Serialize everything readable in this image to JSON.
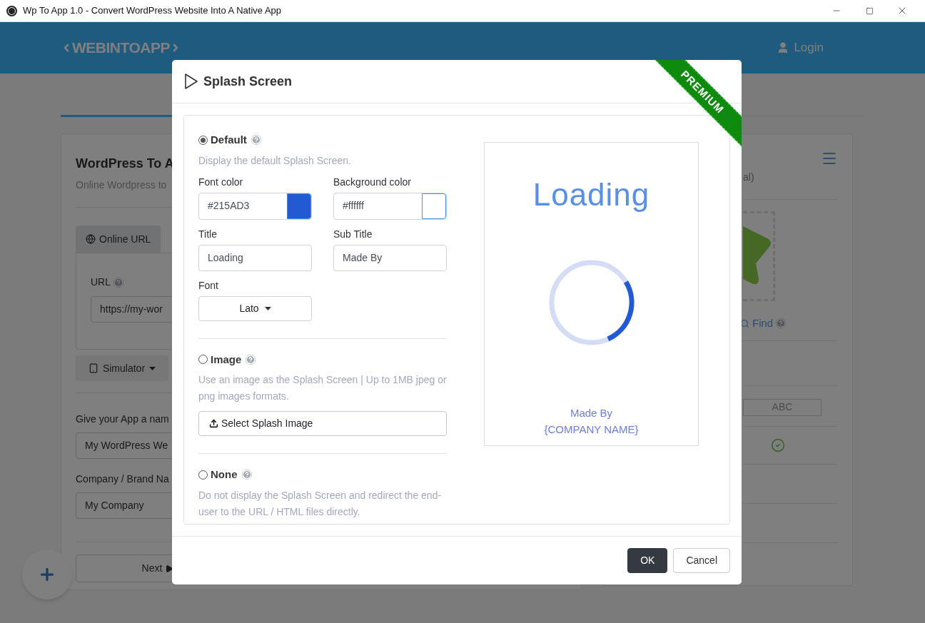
{
  "window": {
    "title": "Wp To App 1.0 - Convert WordPress Website Into A Native App"
  },
  "header": {
    "logo": "WEBINTOAPP",
    "login": "Login"
  },
  "main_card": {
    "title": "WordPress To A",
    "subtitle": "Online Wordpress to",
    "tabs": [
      {
        "label": "Online URL",
        "selected": true
      }
    ],
    "url_label": "URL",
    "url_value": "https://my-wor",
    "simulator": "Simulator",
    "fields": [
      {
        "label": "Give your App a nam",
        "value": "My WordPress We"
      },
      {
        "label": "Company / Brand Na",
        "value": "My Company"
      }
    ],
    "next": "Next"
  },
  "side_card": {
    "caption": "al)",
    "find": "Find",
    "sample": "ABC"
  },
  "dialog": {
    "title": "Splash Screen",
    "ribbon": "PREMIUM",
    "options": [
      {
        "kind": "default",
        "label": "Default",
        "selected": true,
        "description": "Display the default Splash Screen.",
        "fields": [
          {
            "kind": "color",
            "label": "Font color",
            "value": "#215AD3",
            "color": "#215ad3"
          },
          {
            "kind": "color",
            "label": "Background color",
            "value": "#ffffff",
            "color": "#ffffff"
          },
          {
            "kind": "text",
            "label": "Title",
            "value": "Loading"
          },
          {
            "kind": "text",
            "label": "Sub Title",
            "value": "Made By"
          },
          {
            "kind": "select",
            "label": "Font",
            "value": "Lato"
          }
        ]
      },
      {
        "kind": "image",
        "label": "Image",
        "selected": false,
        "description": "Use an image as the Splash Screen | Up to 1MB jpeg or png images formats.",
        "button": "Select Splash Image"
      },
      {
        "kind": "none",
        "label": "None",
        "selected": false,
        "description": "Do not display the Splash Screen and redirect the end-user to the URL / HTML files directly."
      }
    ],
    "preview": {
      "title": "Loading",
      "subtitle": "Made By",
      "company": "{COMPANY NAME}"
    },
    "buttons": [
      {
        "label": "OK",
        "kind": "primary"
      },
      {
        "label": "Cancel",
        "kind": "secondary"
      }
    ]
  }
}
